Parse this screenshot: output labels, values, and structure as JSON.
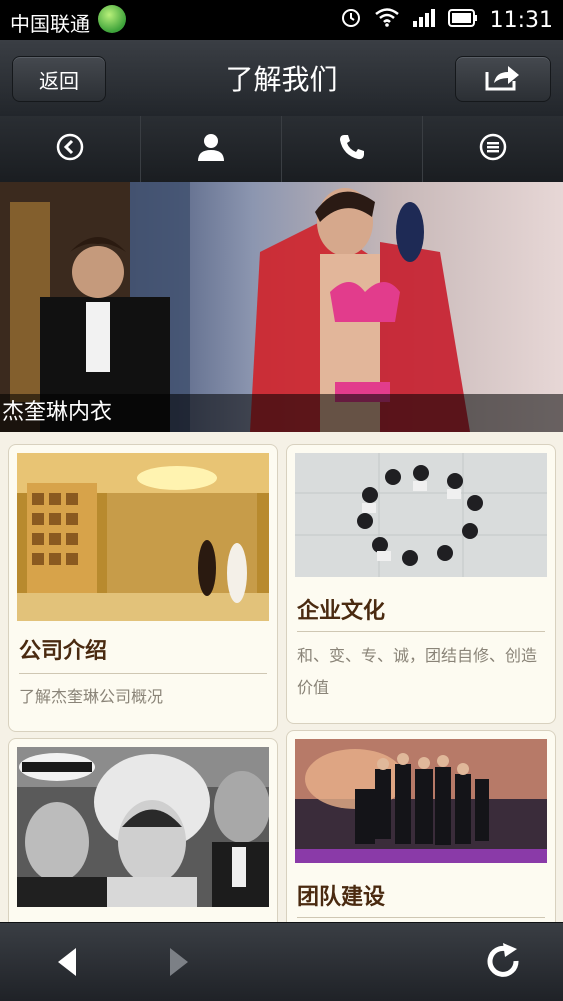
{
  "status_bar": {
    "carrier": "中国联通",
    "time": "11:31"
  },
  "header": {
    "back_label": "返回",
    "title": "了解我们"
  },
  "toolbar": {
    "icons": [
      "back-circle-icon",
      "user-icon",
      "phone-icon",
      "menu-icon"
    ]
  },
  "banner": {
    "caption": "杰奎琳内衣"
  },
  "cards": [
    {
      "title": "公司介绍",
      "description": "了解杰奎琳公司概况"
    },
    {
      "title": "企业文化",
      "description": "和、变、专、诚，团结自修、创造价值"
    },
    {
      "title": ""
    },
    {
      "title": "团队建设"
    }
  ],
  "colors": {
    "card_title": "#4a2a10",
    "card_bg": "#fdfbf1",
    "page_bg": "#f5f1e6"
  }
}
